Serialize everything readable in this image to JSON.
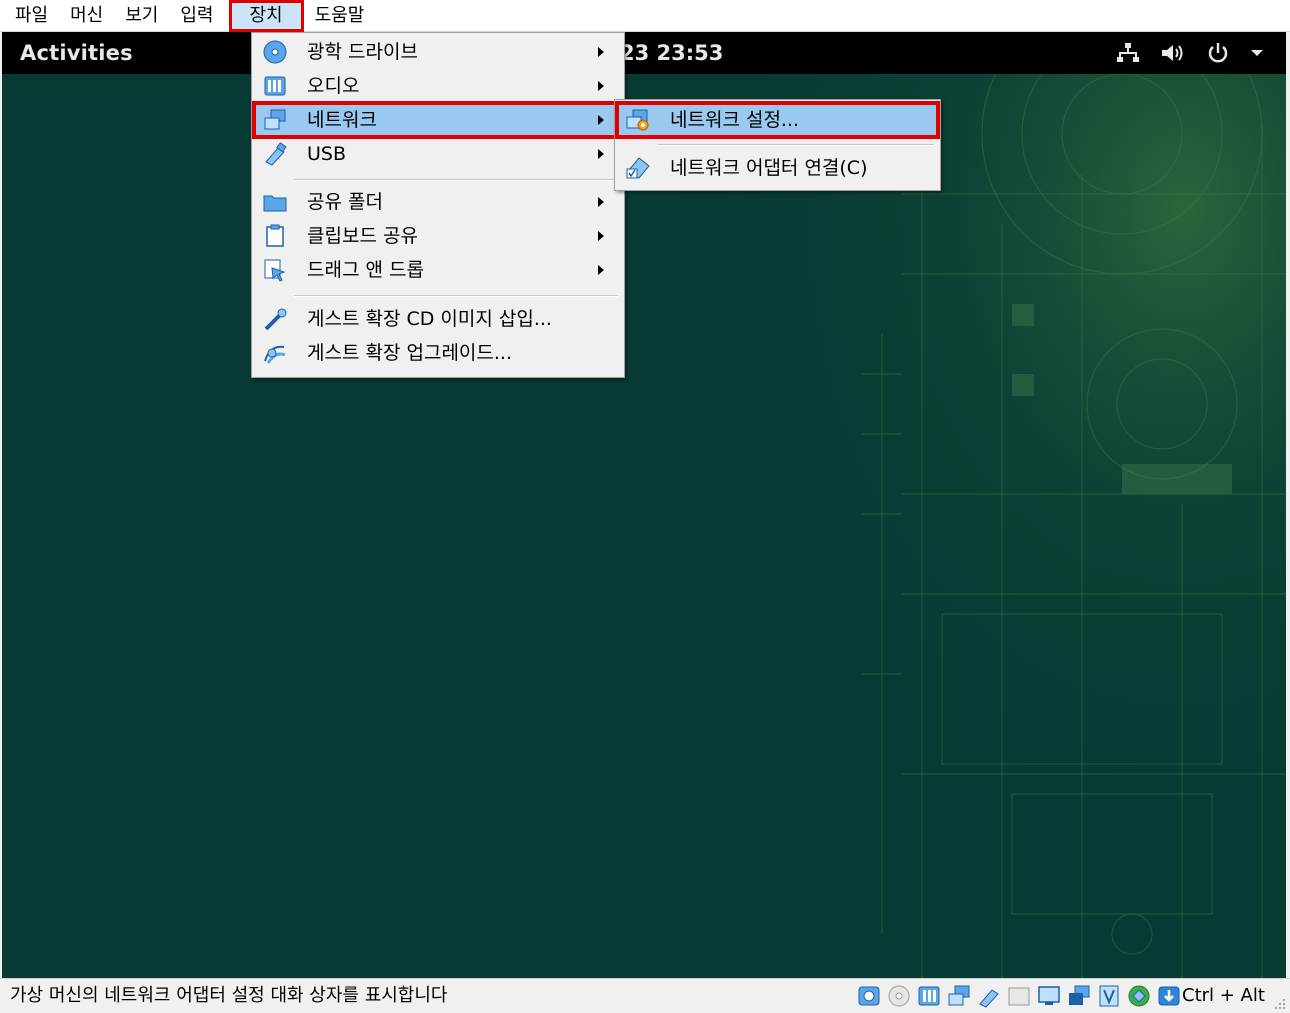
{
  "vbox_menubar": {
    "items": [
      "파일",
      "머신",
      "보기",
      "입력",
      "장치",
      "도움말"
    ],
    "active_index": 4
  },
  "guest": {
    "activities": "Activities",
    "clock": "23 23:53",
    "tray_icons": [
      "network-icon",
      "volume-icon",
      "power-icon",
      "dropdown-arrow-icon"
    ]
  },
  "devices_menu": {
    "items": [
      {
        "label": "광학 드라이브",
        "icon": "optical-drive-icon",
        "submenu": true
      },
      {
        "label": "오디오",
        "icon": "audio-icon",
        "submenu": true
      },
      {
        "label": "네트워크",
        "icon": "network-adapter-icon",
        "submenu": true,
        "highlighted": true
      },
      {
        "label": "USB",
        "icon": "usb-icon",
        "submenu": true
      },
      {
        "label": "공유 폴더",
        "icon": "shared-folder-icon",
        "submenu": true
      },
      {
        "label": "클립보드 공유",
        "icon": "clipboard-icon",
        "submenu": true
      },
      {
        "label": "드래그 앤 드롭",
        "icon": "drag-drop-icon",
        "submenu": true
      },
      {
        "label": "게스트 확장 CD 이미지 삽입...",
        "icon": "guest-additions-cd-icon",
        "submenu": false
      },
      {
        "label": "게스트 확장 업그레이드...",
        "icon": "guest-additions-upgrade-icon",
        "submenu": false
      }
    ]
  },
  "network_submenu": {
    "items": [
      {
        "label": "네트워크 설정...",
        "icon": "network-settings-icon",
        "highlighted": true
      },
      {
        "label": "네트워크 어댑터 연결(C)",
        "icon": "network-connect-icon",
        "highlighted": false
      }
    ]
  },
  "statusbar": {
    "text": "가상 머신의 네트워크 어댑터 설정 대화 상자를 표시합니다",
    "icons": [
      "hard-disk-icon",
      "optical-disk-icon",
      "audio-icon",
      "network-icon",
      "usb-icon",
      "shared-folder-icon",
      "display-icon",
      "video-capture-icon",
      "virtualization-icon",
      "mouse-integration-icon",
      "keyboard-capture-icon"
    ],
    "host_key": "Ctrl + Alt"
  },
  "colors": {
    "highlight": "#99c9ef",
    "annotation_red": "#e00000",
    "wallpaper": "#063a33",
    "topbar": "#000000"
  }
}
